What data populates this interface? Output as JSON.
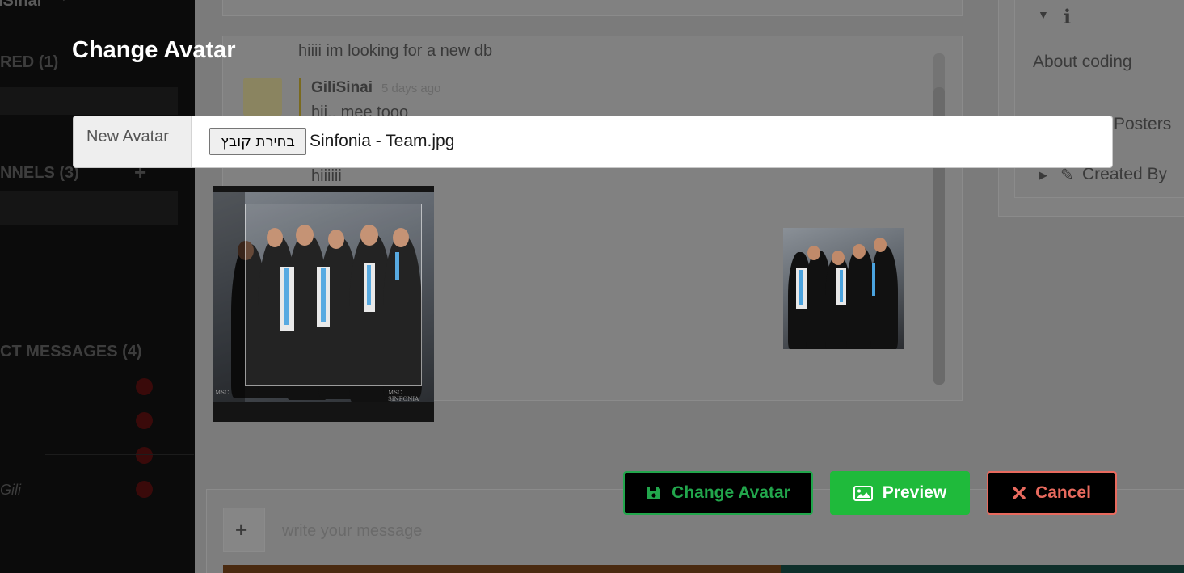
{
  "background": {
    "sidebar": {
      "user_name": "iSinai",
      "starred_header": "RED (1)",
      "channels_header": "NNELS (3)",
      "dm_header": "CT MESSAGES (4)",
      "dm_item": "Gili"
    },
    "chat": {
      "message_prev": "hiiii im looking for a new db",
      "author": "GiliSinai",
      "time": "5 days ago",
      "message_reply": "hii.. mee tooo",
      "message_short": "hiiiiii",
      "message_input_placeholder": "write your message"
    },
    "info_panel": {
      "about": "About coding",
      "posters": "Posters",
      "created_by": "Created By"
    }
  },
  "modal": {
    "title": "Change Avatar",
    "input_label": "New Avatar",
    "file_button_label": "בחירת קובץ",
    "file_name": "Sinfonia - Team.jpg",
    "photo_caption_left": "MSC",
    "photo_caption_right": "MSC SINFONIA"
  },
  "buttons": {
    "change_avatar": "Change Avatar",
    "preview": "Preview",
    "cancel": "Cancel"
  },
  "colors": {
    "change_avatar": "#22a64c",
    "preview": "#1fba3b",
    "cancel": "#e86a5e"
  }
}
